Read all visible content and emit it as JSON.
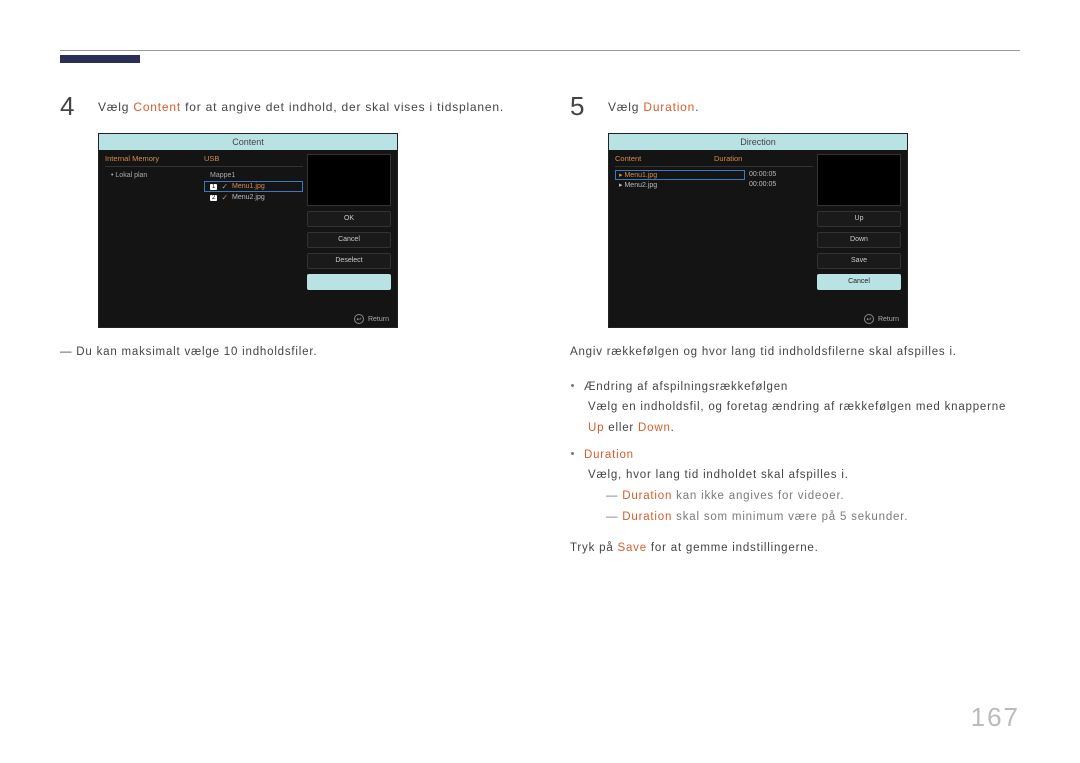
{
  "page_number": "167",
  "step4": {
    "num": "4",
    "prefix": "Vælg ",
    "keyword": "Content",
    "suffix": " for at angive det indhold, der skal vises i tidsplanen."
  },
  "device4": {
    "title": "Content",
    "head_left": "Internal Memory",
    "head_right": "USB",
    "left_item": "Lokal plan",
    "folder": "Mappe1",
    "file1_num": "1",
    "file1": "Menu1.jpg",
    "file2_num": "2",
    "file2": "Menu2.jpg",
    "btn_ok": "OK",
    "btn_cancel": "Cancel",
    "btn_deselect": "Deselect",
    "return": "Return"
  },
  "note4": "Du kan maksimalt vælge 10 indholdsfiler.",
  "step5": {
    "num": "5",
    "prefix": "Vælg ",
    "keyword": "Duration",
    "suffix": "."
  },
  "device5": {
    "title": "Direction",
    "head_left": "Content",
    "head_right": "Duration",
    "file1": "Menu1.jpg",
    "dur1": "00:00:05",
    "file2": "Menu2.jpg",
    "dur2": "00:00:05",
    "btn_up": "Up",
    "btn_down": "Down",
    "btn_save": "Save",
    "btn_cancel": "Cancel",
    "return": "Return"
  },
  "para5_intro": "Angiv rækkefølgen og hvor lang tid indholdsfilerne skal afspilles i.",
  "bullet5a_head": "Ændring af afspilningsrækkefølgen",
  "bullet5a_line": {
    "part1": "Vælg en indholdsfil, og foretag ændring af rækkefølgen med knapperne ",
    "up": "Up",
    "mid": " eller ",
    "down": "Down",
    "end": "."
  },
  "bullet5b_head": "Duration",
  "bullet5b_line": "Vælg, hvor lang tid indholdet skal afspilles i.",
  "sub_dur1": {
    "kw": "Duration",
    "rest": " kan ikke angives for videoer."
  },
  "sub_dur2": {
    "kw": "Duration",
    "rest": " skal som minimum være på 5 sekunder."
  },
  "closing": {
    "part1": "Tryk på ",
    "save": "Save",
    "part2": " for at gemme indstillingerne."
  }
}
